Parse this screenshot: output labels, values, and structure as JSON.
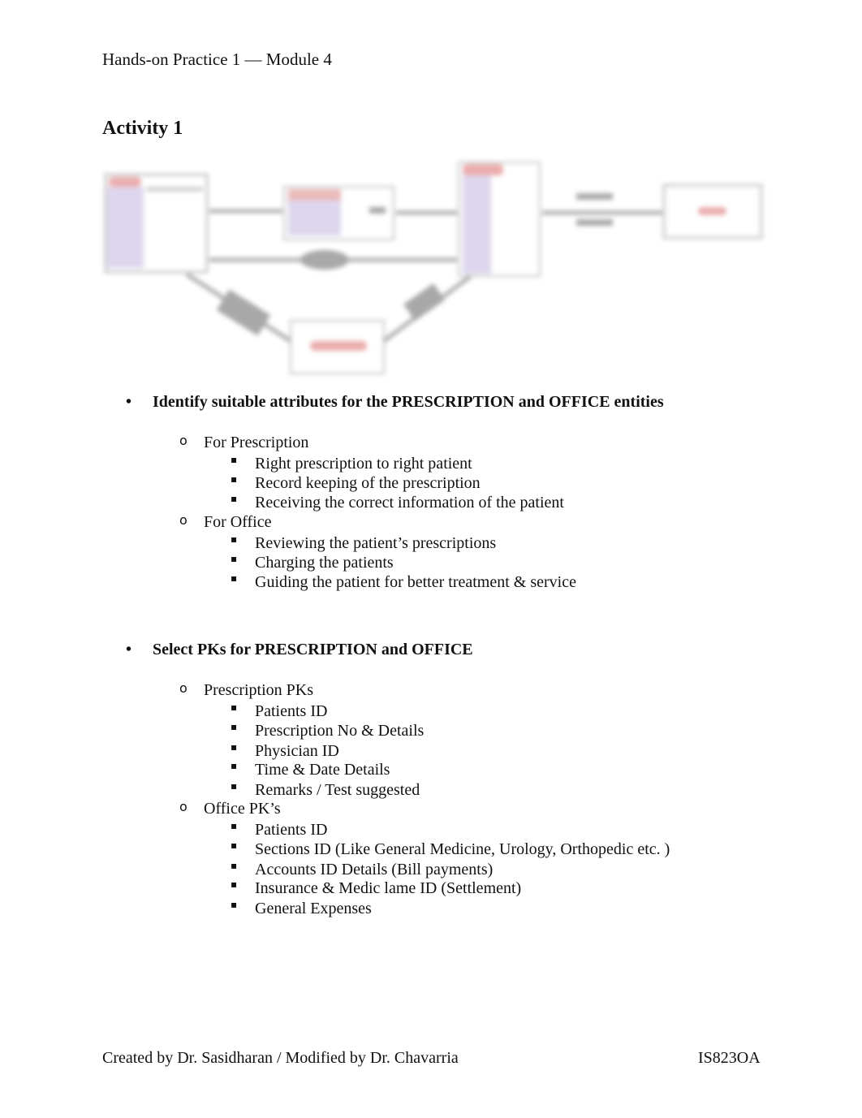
{
  "header": {
    "text": "Hands-on Practice 1 — Module 4"
  },
  "activity": {
    "title": "Activity 1"
  },
  "diagram": {
    "description": "Blurred entity-relationship diagram (text unreadable)",
    "colors": {
      "entity_header": "#e8a0a0",
      "entity_body": "#d8d0ec",
      "line": "#9a9a9a"
    }
  },
  "bullets": {
    "marker_l1": "•",
    "marker_l2": "o",
    "marker_l3": "▪"
  },
  "sections": [
    {
      "heading": "Identify suitable attributes for the PRESCRIPTION and OFFICE entities",
      "groups": [
        {
          "label": "For Prescription",
          "items": [
            "Right prescription to right patient",
            "Record keeping of the prescription",
            "Receiving the correct information of the patient"
          ]
        },
        {
          "label": "For Office",
          "items": [
            "Reviewing the patient’s prescriptions",
            "Charging the patients",
            "Guiding the patient for better treatment & service"
          ]
        }
      ]
    },
    {
      "heading": "Select PKs for PRESCRIPTION and OFFICE",
      "groups": [
        {
          "label": "Prescription PKs",
          "items": [
            "Patients ID",
            "Prescription No & Details",
            "Physician ID",
            "Time & Date Details",
            "Remarks / Test suggested"
          ]
        },
        {
          "label": "Office PK’s",
          "items": [
            "Patients ID",
            "Sections ID (Like General Medicine, Urology, Orthopedic etc. )",
            "Accounts ID Details (Bill payments)",
            "Insurance & Medic lame ID (Settlement)",
            "General Expenses"
          ]
        }
      ]
    }
  ],
  "footer": {
    "left": "Created by Dr. Sasidharan / Modified by Dr. Chavarria",
    "right": "IS823OA"
  }
}
